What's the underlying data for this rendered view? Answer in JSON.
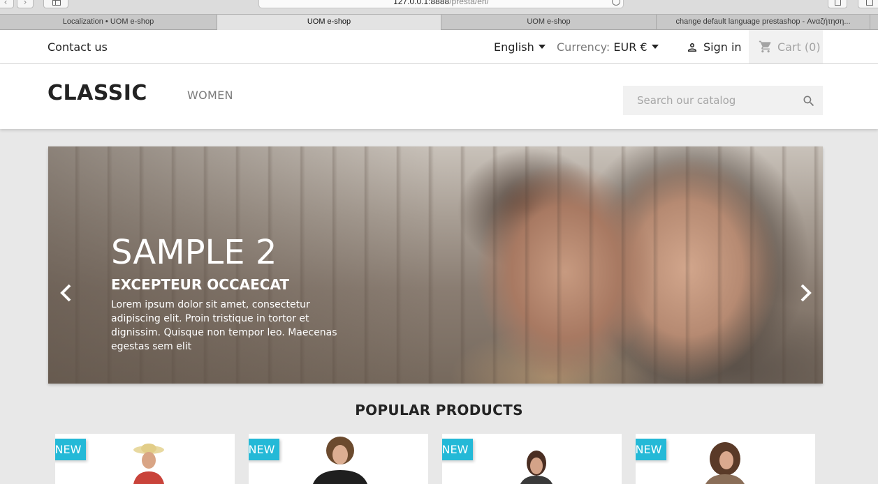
{
  "browser": {
    "url_host": "127.0.0.1:8888",
    "url_path": "/presta/en/",
    "tabs": [
      {
        "label": "Localization • UOM e-shop",
        "active": false
      },
      {
        "label": "UOM e-shop",
        "active": true
      },
      {
        "label": "UOM e-shop",
        "active": false
      },
      {
        "label": "change default language prestashop - Αναζήτηση...",
        "active": false
      }
    ]
  },
  "header": {
    "contact": "Contact us",
    "language": "English",
    "currency_label": "Currency:",
    "currency_value": "EUR €",
    "signin": "Sign in",
    "cart": "Cart (0)"
  },
  "brand": {
    "logo": "CLASSIC",
    "menu": [
      "WOMEN"
    ],
    "search_placeholder": "Search our catalog"
  },
  "carousel": {
    "title": "SAMPLE 2",
    "subtitle": "EXCEPTEUR OCCAECAT",
    "description": "Lorem ipsum dolor sit amet, consectetur adipiscing elit. Proin tristique in tortor et dignissim. Quisque non tempor leo. Maecenas egestas sem elit"
  },
  "products": {
    "title": "POPULAR PRODUCTS",
    "items": [
      {
        "badge": "NEW"
      },
      {
        "badge": "NEW"
      },
      {
        "badge": "NEW"
      },
      {
        "badge": "NEW"
      }
    ]
  },
  "colors": {
    "badge": "#24b9d7",
    "text": "#232323",
    "muted": "#7a7a7a",
    "background": "#e8e8e8"
  }
}
